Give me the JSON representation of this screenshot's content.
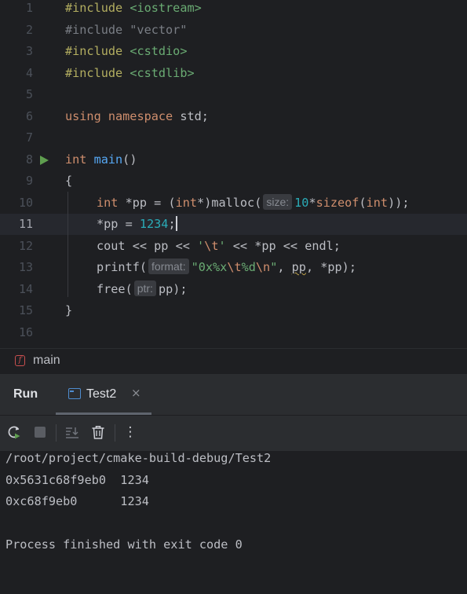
{
  "editor": {
    "line_numbers": [
      "1",
      "2",
      "3",
      "4",
      "5",
      "6",
      "7",
      "8",
      "9",
      "10",
      "11",
      "12",
      "13",
      "14",
      "15",
      "16"
    ],
    "current_line": "11",
    "code": {
      "l1_directive": "#include",
      "l1_header": "<iostream>",
      "l2_text": "#include \"vector\"",
      "l3_directive": "#include",
      "l3_header": "<cstdio>",
      "l4_directive": "#include",
      "l4_header": "<cstdlib>",
      "l6_using": "using",
      "l6_namespace": "namespace",
      "l6_std": "std;",
      "l8_int": "int",
      "l8_main": "main",
      "l8_parens": "()",
      "l9_brace": "{",
      "l10_int": "int",
      "l10_decl": "*pp = (",
      "l10_cast": "int",
      "l10_malloc": "*)malloc(",
      "l10_hint": "size:",
      "l10_num": "10",
      "l10_star": "*",
      "l10_sizeof": "sizeof",
      "l10_open": "(",
      "l10_int2": "int",
      "l10_close": "));",
      "l11_assign": "*pp = ",
      "l11_num": "1234",
      "l11_semi": ";",
      "l12_a": "cout << pp << ",
      "l12_q1": "'",
      "l12_esc": "\\t",
      "l12_q2": "'",
      "l12_b": " << *pp << endl;",
      "l13_a": "printf(",
      "l13_hint": "format:",
      "l13_s1": "\"0x%x",
      "l13_e1": "\\t",
      "l13_s2": "%d",
      "l13_e2": "\\n",
      "l13_s3": "\"",
      "l13_b": ", ",
      "l13_pp": "pp",
      "l13_c": ", *pp);",
      "l14_a": "free(",
      "l14_hint": "ptr:",
      "l14_b": "pp);",
      "l15_brace": "}"
    }
  },
  "breadcrumb": {
    "badge": "f",
    "label": "main"
  },
  "run_panel": {
    "title": "Run",
    "tab_label": "Test2",
    "tab_close": "×",
    "more": "⋮",
    "console_lines": [
      "/root/project/cmake-build-debug/Test2",
      "0x5631c68f9eb0  1234",
      "0xc68f9eb0      1234",
      "",
      "Process finished with exit code 0"
    ]
  },
  "icons": {
    "run_gutter": "run-triangle-icon",
    "rerun": "rerun-icon",
    "stop": "stop-icon",
    "scroll_to_end": "scroll-to-end-icon",
    "clear": "trash-icon",
    "more": "more-vertical-icon"
  },
  "colors": {
    "keyword": "#cf8e6d",
    "function": "#56a8f5",
    "number": "#2aacb8",
    "string": "#6aab73",
    "run_green": "#5f9e4f"
  }
}
